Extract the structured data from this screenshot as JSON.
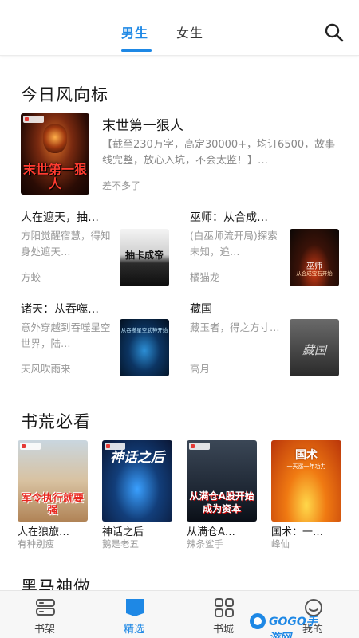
{
  "header": {
    "tabs": [
      {
        "label": "男生",
        "active": true
      },
      {
        "label": "女生",
        "active": false
      }
    ],
    "search_icon": "search-icon"
  },
  "sections": {
    "wind": {
      "title": "今日风向标",
      "featured": {
        "title": "末世第一狠人",
        "desc": "【截至230万字，高定30000+，均订6500，故事线完整，放心入坑，不会太监！】…",
        "author": "差不多了",
        "cover_text": "末世第一狠人"
      },
      "items": [
        {
          "title": "人在遮天，抽…",
          "desc": "方阳觉醒宿慧，得知身处遮天…",
          "author": "方蛟",
          "cover_text": "抽卡成帝",
          "cover_top": "人在遮天"
        },
        {
          "title": "巫师：从合成…",
          "desc": "(白巫师流开局)探索未知，追…",
          "author": "橘猫龙",
          "cover_text": "巫师",
          "cover_sub": "从合成宝石开始"
        },
        {
          "title": "诸天：从吞噬…",
          "desc": "意外穿越到吞噬星空世界，陆…",
          "author": "天风吹雨来",
          "cover_text": "从吞噬星空武神开始"
        },
        {
          "title": "藏国",
          "desc": "藏玉者，得之方寸…",
          "author": "高月",
          "cover_text": "藏国"
        }
      ]
    },
    "shortage": {
      "title": "书荒必看",
      "books": [
        {
          "title": "人在狼旅…",
          "author": "有种别瘦",
          "cover_text": "军令执行就要强"
        },
        {
          "title": "神话之后",
          "author": "鹅是老五",
          "cover_text": "神话之后"
        },
        {
          "title": "从满仓A…",
          "author": "辣条鲨手",
          "cover_text": "从满仓A股开始成为资本"
        },
        {
          "title": "国术：一…",
          "author": "峰仙",
          "cover_text": "国术",
          "cover_sub": "一天涨一年功力"
        }
      ]
    },
    "dark_horse": {
      "title": "黑马神做"
    }
  },
  "bottom_nav": {
    "items": [
      {
        "label": "书架",
        "icon": "bookshelf-icon"
      },
      {
        "label": "精选",
        "icon": "featured-book-icon",
        "active": true
      },
      {
        "label": "书城",
        "icon": "grid-icon"
      },
      {
        "label": "我的",
        "icon": "profile-icon"
      }
    ]
  },
  "watermark": {
    "text": "GOGO手游网"
  },
  "colors": {
    "accent": "#1e88e5",
    "text": "#1a1a1a",
    "muted": "#999999"
  }
}
